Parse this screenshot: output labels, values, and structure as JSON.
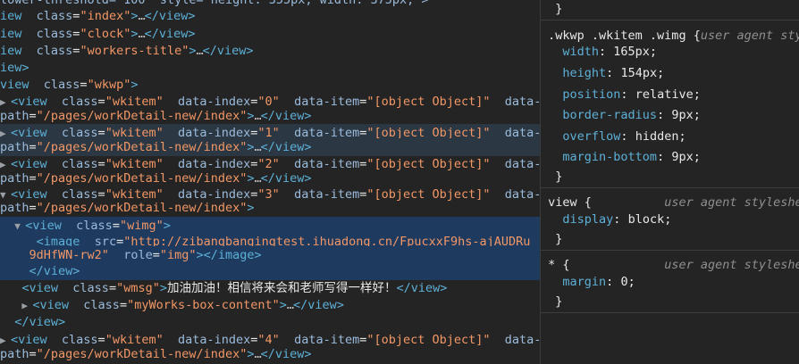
{
  "dom": {
    "line0": {
      "pre": "lower-threshold=\"100\" style=\"height: 355px; width: 375px;\">"
    },
    "line1": {
      "a": "iew",
      "b": "class",
      "c": "\"index\"",
      "d": ">",
      "e": "…",
      "f": "</view>"
    },
    "line2": {
      "a": "iew",
      "b": "class",
      "c": "\"clock\"",
      "d": ">",
      "e": "…",
      "f": "</view>"
    },
    "line3": {
      "a": "iew",
      "b": "class",
      "c": "\"workers-title\"",
      "d": ">",
      "e": "…",
      "f": "</view>"
    },
    "line4": {
      "a": "iew>"
    },
    "line5": {
      "a": "view",
      "b": "class",
      "c": "\"wkwp\"",
      "d": ">"
    },
    "items": [
      {
        "index": "\"0\"",
        "item": "\"[object Object]\"",
        "path": "\"/pages/workDetail-new/index\""
      },
      {
        "index": "\"1\"",
        "item": "\"[object Object]\"",
        "path": "\"/pages/workDetail-new/index\""
      },
      {
        "index": "\"2\"",
        "item": "\"[object Object]\"",
        "path": "\"/pages/workDetail-new/index\""
      },
      {
        "index": "\"3\"",
        "item": "\"[object Object]\"",
        "path": "\"/pages/workDetail-new/index\""
      }
    ],
    "item4": {
      "index": "\"4\"",
      "item": "\"[object Object]\"",
      "path": "\"/pages/workDetail-new/index\""
    },
    "common": {
      "view_open": "<view",
      "class_attr": "class",
      "wkitem_val": "\"wkitem\"",
      "data_index_attr": "data-index",
      "data_item_attr": "data-item",
      "data_tail": "data-",
      "path_attr": "path",
      "close_gt": ">",
      "ellipsis": "…",
      "view_close": "</view>"
    },
    "wimg": {
      "tag": "<view",
      "attr": "class",
      "val": "\"wimg\"",
      "gt": ">"
    },
    "image": {
      "tag": "<image",
      "src_attr": "src",
      "src_val_1": "\"http://zibangbangingtest.ihuadong.cn/FpucxxF9hs-ajAUDRu",
      "src_val_2": "9dHfWN-rw2\"",
      "role_attr": "role",
      "role_val": "\"img\"",
      "close": "></image>"
    },
    "wimg_close": "</view>",
    "wmsg": {
      "tag": "<view",
      "attr": "class",
      "val": "\"wmsg\"",
      "gt": ">",
      "text": "加油加油！相信将来会和老师写得一样好！",
      "close": "</view>"
    },
    "box": {
      "tag": "<view",
      "attr": "class",
      "val": "\"myWorks-box-content\"",
      "gt": ">",
      "ell": "…",
      "close": "</view>"
    },
    "outer_close": "</view>"
  },
  "styles": {
    "top_brace": "}",
    "rule1": {
      "selector": ".wkwp .wkitem .wimg {",
      "origin": "user agent sty",
      "props": [
        {
          "name": "width",
          "value": "165px;"
        },
        {
          "name": "height",
          "value": "154px;"
        },
        {
          "name": "position",
          "value": "relative;"
        },
        {
          "name": "border-radius",
          "value": "9px;"
        },
        {
          "name": "overflow",
          "value": "hidden;"
        },
        {
          "name": "margin-bottom",
          "value": "9px;"
        }
      ],
      "close": "}"
    },
    "rule2": {
      "selector": "view {",
      "origin": "user agent styleshe",
      "prop": "display",
      "value": "block;",
      "close": "}"
    },
    "rule3": {
      "selector": "* {",
      "origin": "user agent styleshe",
      "prop": "margin",
      "value": "0;",
      "close": "}"
    }
  }
}
